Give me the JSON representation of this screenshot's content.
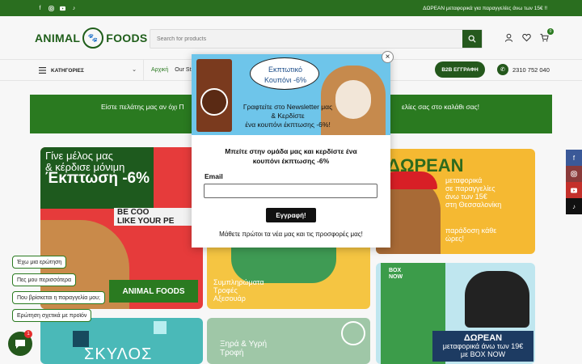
{
  "topbar": {
    "socials": [
      "facebook-icon",
      "instagram-icon",
      "youtube-icon",
      "tiktok-icon"
    ],
    "promo": "ΔΩΡΕΑΝ μεταφορικά για παραγγελίες άνω των 15€ !!"
  },
  "header": {
    "logo_text_left": "ANIMAL",
    "logo_text_right": "FOODS",
    "search_placeholder": "Search for products",
    "cart_count": "0"
  },
  "nav": {
    "categories_label": "ΚΑΤΗΓΟΡΙΕΣ",
    "links": [
      "Αρχική",
      "Our St"
    ],
    "b2b_label": "B2B ΕΓΓΡΑΦΗ",
    "phone": "2310 752 040"
  },
  "notice": {
    "left_text": "Είστε πελάτης μας αν όχι Π",
    "right_text": "ελίες σας στο καλάθι σας!"
  },
  "tiles": {
    "member": {
      "line1": "Γίνε μέλος μας",
      "line2": "& κέρδισε μόνιμη",
      "discount": "Έκπτωση -6%",
      "coupon": "BE COO",
      "coupon2": "LIKE YOUR PE",
      "brand": "ANIMAL FOODS"
    },
    "birds": {
      "line1": "Συμπληρώματα",
      "line2": "Τροφές",
      "line3": "Αξεσουάρ"
    },
    "free_shipping": {
      "title": "ΔΩΡΕΑΝ",
      "line1": "μεταφορικά",
      "line2": "σε παραγγελίες",
      "line3": "άνω των 15€",
      "line4": "στη Θεσσαλονίκη",
      "line5": "παράδοση κάθε",
      "line6": "ώρες!"
    },
    "boxnow": {
      "label1": "BOX",
      "label2": "NOW",
      "caption1": "ΔΩΡΕΑΝ",
      "caption2": "μεταφορικά άνω των 19€",
      "caption3": "με BOX NOW"
    },
    "dogs": {
      "text": "ΣΚΥΛΟΣ"
    },
    "food": {
      "line1": "Ξηρά & Υγρή",
      "line2": "Τροφή"
    }
  },
  "chat": {
    "quick_replies": [
      "Έχω μια ερώτηση",
      "Πες μου περισσότερα",
      "Που βρίσκεται η παραγγελία μου;",
      "Ερώτηση σχετικά με προϊόν"
    ],
    "unread": "1"
  },
  "side_socials": [
    "facebook-icon",
    "instagram-icon",
    "youtube-icon",
    "tiktok-icon"
  ],
  "modal": {
    "bubble_line1": "Εκπτωτικό",
    "bubble_line2": "Κουπόνι -6%",
    "news_line1": "Γραφτείτε στο Newsletter μας",
    "news_line2": "& Κερδίστε",
    "news_line3": "ένα κουπόνι έκπτωσης -6%!",
    "close": "×",
    "heading_line1": "Μπείτε στην ομάδα μας και κερδίστε ένα",
    "heading_line2": "κουπόνι έκπτωσης -6%",
    "email_label": "Email",
    "submit_label": "Εγγραφή!",
    "footer_text": "Μάθετε πρώτοι τα νέα μας και τις προσφορές μας!"
  },
  "colors": {
    "brand_green": "#2a6e1f",
    "dark_green": "#24581c",
    "notice_green": "#2a7a20"
  }
}
